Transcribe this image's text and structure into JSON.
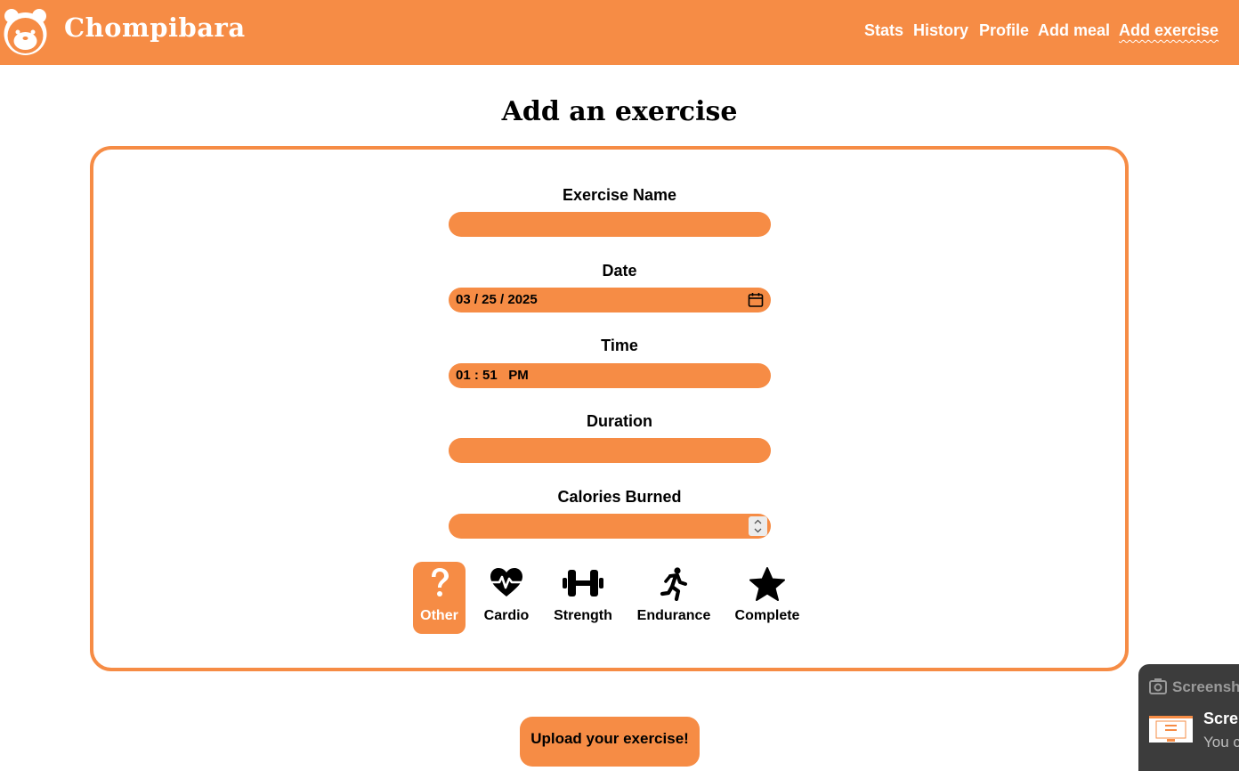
{
  "colors": {
    "accent": "#f68c45",
    "text": "#000000",
    "background": "#ffffff"
  },
  "navbar": {
    "brand": "Chompibara",
    "logo_icon": "capybara-face-icon",
    "links": [
      {
        "label": "Stats"
      },
      {
        "label": "History"
      },
      {
        "label": "Profile"
      },
      {
        "label": "Add meal"
      },
      {
        "label": "Add exercise",
        "active": true
      }
    ]
  },
  "page": {
    "title": "Add an exercise"
  },
  "form": {
    "exercise_name": {
      "label": "Exercise Name",
      "value": ""
    },
    "date": {
      "label": "Date",
      "value": "03 / 25 / 2025",
      "icon": "calendar-icon"
    },
    "time": {
      "label": "Time",
      "value": "01 : 51   PM"
    },
    "duration": {
      "label": "Duration",
      "value": ""
    },
    "calories": {
      "label": "Calories Burned",
      "value": ""
    },
    "categories": [
      {
        "label": "Other",
        "icon": "question-mark-icon",
        "selected": true
      },
      {
        "label": "Cardio",
        "icon": "heart-pulse-icon",
        "selected": false
      },
      {
        "label": "Strength",
        "icon": "dumbbell-icon",
        "selected": false
      },
      {
        "label": "Endurance",
        "icon": "running-person-icon",
        "selected": false
      },
      {
        "label": "Complete",
        "icon": "star-icon",
        "selected": false
      }
    ],
    "submit_label": "Upload your exercise!"
  },
  "toast": {
    "header": "Screensh",
    "title": "Scre",
    "body": "You c",
    "icon": "screenshot-icon"
  }
}
